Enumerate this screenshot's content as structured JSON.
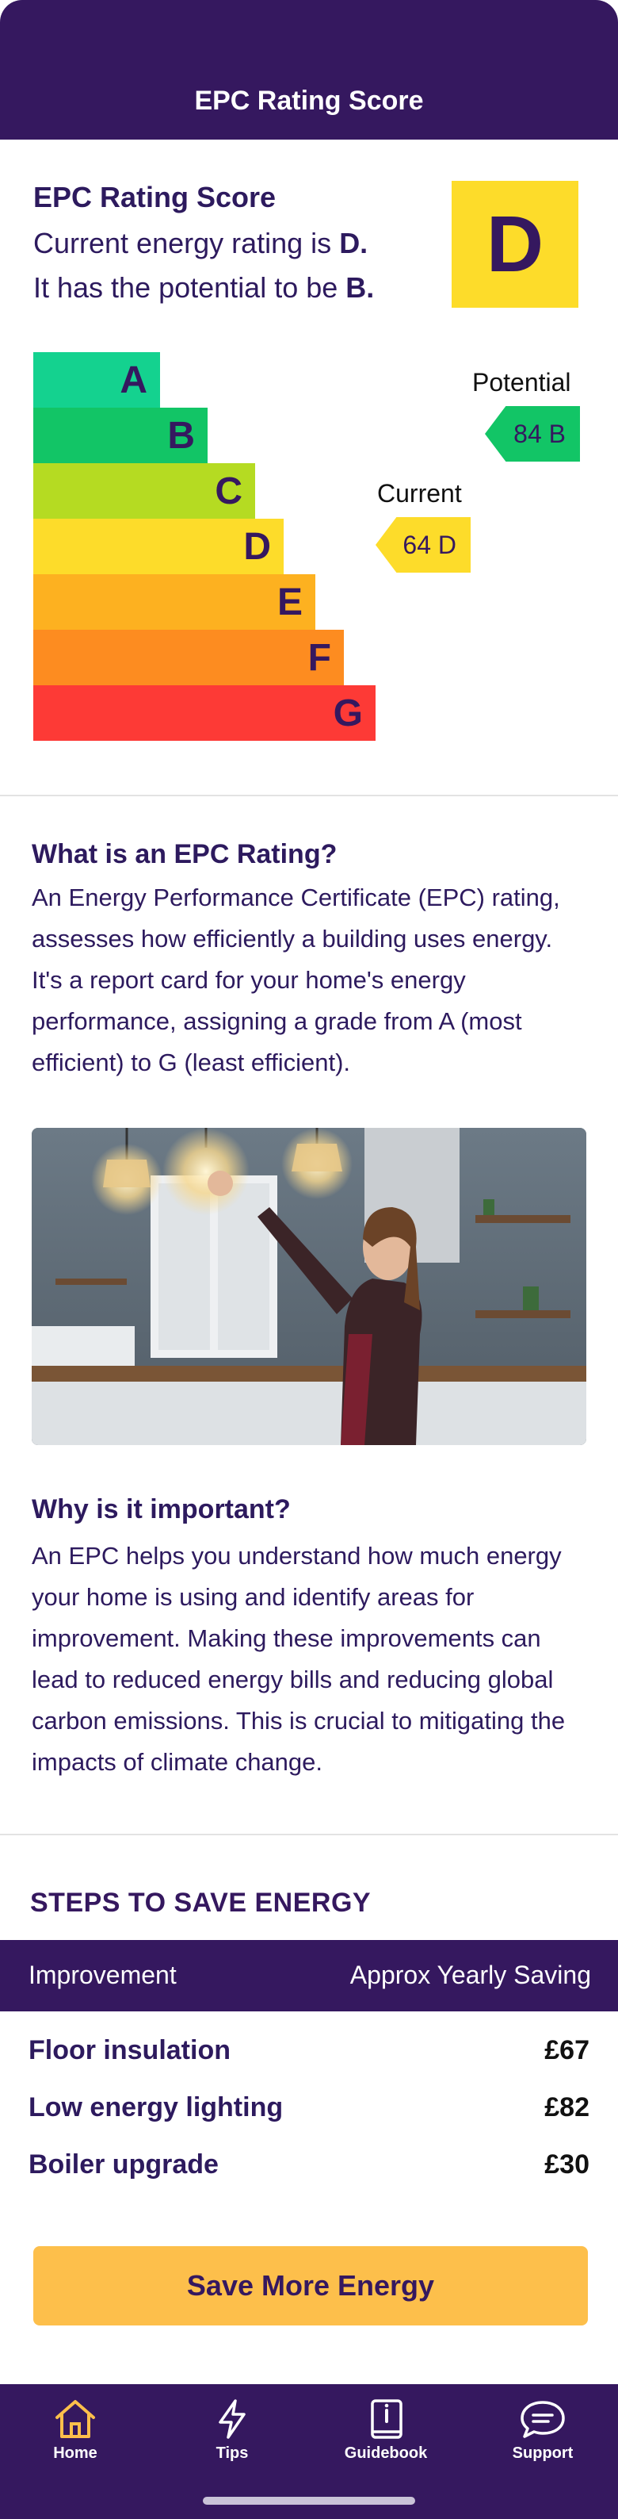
{
  "header": {
    "title": "EPC Rating Score"
  },
  "epc": {
    "heading": "EPC Rating Score",
    "current_prefix": "Current energy rating is ",
    "current_grade_text": "D.",
    "potential_prefix": "It has the potential to be ",
    "potential_grade_text": "B.",
    "grade_box": "D",
    "grade_box_color": "#FDDC2A"
  },
  "scale": {
    "bands": [
      {
        "letter": "A",
        "color": "#14D28F"
      },
      {
        "letter": "B",
        "color": "#12C566"
      },
      {
        "letter": "C",
        "color": "#B5DB22"
      },
      {
        "letter": "D",
        "color": "#FDDC2A"
      },
      {
        "letter": "E",
        "color": "#FDB120"
      },
      {
        "letter": "F",
        "color": "#FD8C20"
      },
      {
        "letter": "G",
        "color": "#FD3A36"
      }
    ],
    "potential_label": "Potential",
    "potential_value": "84 B",
    "current_label": "Current",
    "current_value": "64 D"
  },
  "about": {
    "title": "What is an EPC Rating?",
    "body": "An Energy Performance Certificate (EPC) rating, assesses how efficiently a building uses energy. It's a report card for your home's energy performance, assigning a grade from A (most efficient) to G (least efficient)."
  },
  "important": {
    "title": "Why is it important?",
    "body": "An EPC helps you understand how much energy your home is using and identify areas for improvement. Making these improvements can lead to reduced energy bills and reducing global carbon emissions. This is crucial to mitigating the impacts of climate change."
  },
  "steps": {
    "title": "STEPS TO SAVE ENERGY",
    "col_improvement": "Improvement",
    "col_saving": "Approx Yearly Saving",
    "rows": [
      {
        "name": "Floor insulation",
        "saving": "£67"
      },
      {
        "name": "Low energy lighting",
        "saving": "£82"
      },
      {
        "name": "Boiler upgrade",
        "saving": "£30"
      }
    ],
    "cta": "Save More Energy"
  },
  "nav": {
    "items": [
      {
        "label": "Home",
        "icon": "home-icon"
      },
      {
        "label": "Tips",
        "icon": "lightning-icon"
      },
      {
        "label": "Guidebook",
        "icon": "book-icon"
      },
      {
        "label": "Support",
        "icon": "chat-bubble-icon"
      }
    ]
  },
  "colors": {
    "brand": "#35185F",
    "accent": "#FDBF4B"
  }
}
